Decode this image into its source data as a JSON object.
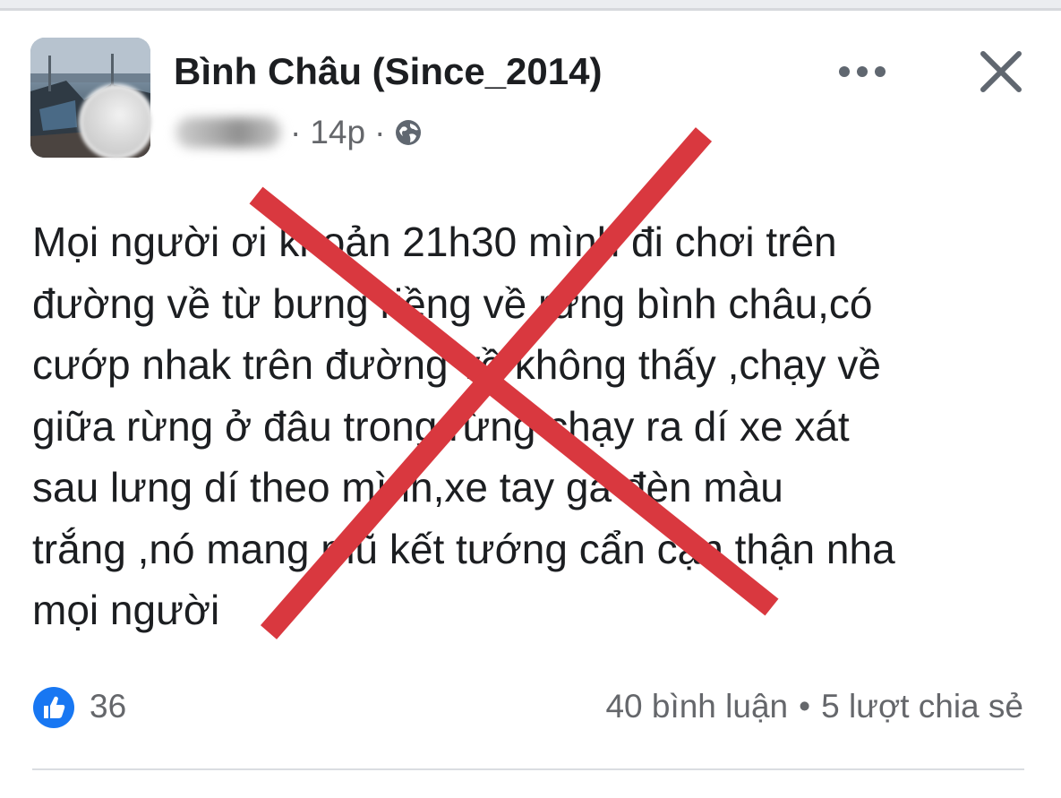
{
  "post": {
    "group_name": "Bình Châu (Since_2014)",
    "time": "14p",
    "meta_separator": "·",
    "text": "Mọi người ơi khoản 21h30 mình đi chơi trên\nđường về từ bưng riềng về rừng bình châu,có\ncướp nhak trên đường về không thấy ,chạy về\ngiữa rừng ở  đâu trong rừng chạy ra dí xe xát\nsau lưng dí theo mình,xe tay ga đèn màu\ntrắng ,nó mang mũ kết tướng cẩn cận thận nha\nmọi người",
    "reactions_count": "36",
    "comments": "40 bình luận",
    "dot": "•",
    "shares": "5 lượt chia sẻ"
  },
  "icons": {
    "privacy": "globe-icon",
    "more": "more-options-icon",
    "close": "close-icon",
    "reaction": "like-icon"
  },
  "colors": {
    "overlay_x": "#d9383f",
    "like_blue": "#1877f2",
    "secondary_text": "#65676b"
  }
}
